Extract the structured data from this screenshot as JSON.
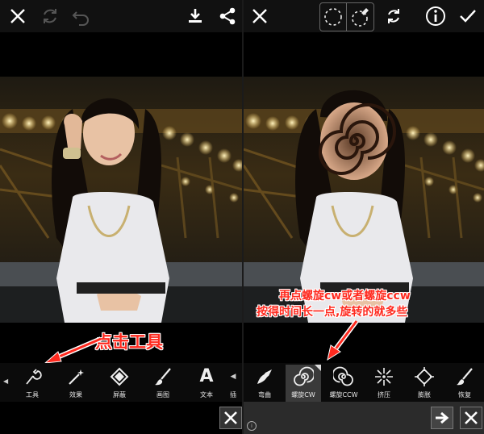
{
  "left_panel": {
    "toolbar": {
      "close_icon": "close-icon",
      "rotate_icon": "rotate-icon",
      "undo_icon": "undo-icon",
      "download_icon": "download-icon",
      "share_icon": "share-icon"
    },
    "annotation": "点击工具",
    "tools": [
      {
        "label": "工具",
        "icon": "tool-icon"
      },
      {
        "label": "效果",
        "icon": "magic-wand-icon"
      },
      {
        "label": "屏蔽",
        "icon": "diamond-icon"
      },
      {
        "label": "画图",
        "icon": "brush-icon"
      },
      {
        "label": "文本",
        "icon": "text-icon"
      },
      {
        "label": "插",
        "icon": "insert-icon"
      }
    ]
  },
  "right_panel": {
    "toolbar": {
      "close_icon": "close-icon",
      "lasso_icon": "lasso-icon",
      "erase_selection_icon": "erase-selection-icon",
      "refresh_icon": "refresh-icon",
      "info_icon": "info-icon",
      "check_icon": "check-icon"
    },
    "annotation_line1": "再点螺旋cw或者螺旋ccw",
    "annotation_line2": "按得时间长一点,旋转的就多些",
    "tools": [
      {
        "label": "弯曲",
        "icon": "bend-icon"
      },
      {
        "label": "螺旋CW",
        "icon": "spiral-cw-icon"
      },
      {
        "label": "螺旋CCW",
        "icon": "spiral-ccw-icon"
      },
      {
        "label": "挤压",
        "icon": "pinch-icon"
      },
      {
        "label": "膨胀",
        "icon": "bloat-icon"
      },
      {
        "label": "恢复",
        "icon": "restore-icon"
      }
    ]
  },
  "colors": {
    "annotation_red": "#ff2a1f",
    "toolbar_bg": "#111111",
    "selected_tool_bg": "#3a3a3a"
  }
}
